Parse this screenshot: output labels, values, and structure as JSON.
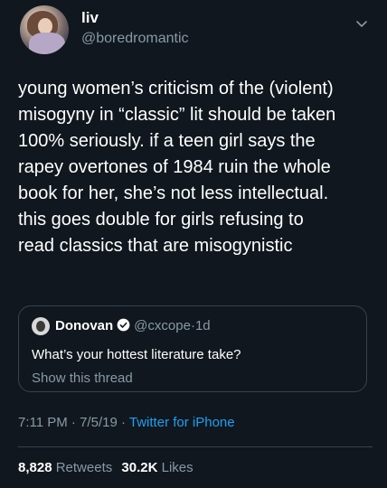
{
  "user": {
    "display_name": "liv",
    "handle": "@boredromantic"
  },
  "tweet": {
    "lines": [
      "young women’s criticism of the (violent)",
      "misogyny in “classic” lit should be taken",
      "100% seriously. if a teen girl says the",
      "rapey overtones of 1984 ruin the whole",
      "book for her, she’s not less intellectual.",
      "this goes double for girls refusing to",
      "read classics that are misogynistic"
    ]
  },
  "quoted": {
    "name": "Donovan",
    "handle": "@cxcope",
    "separator": "·",
    "time": "1d",
    "text": "What’s your hottest literature take?",
    "link": "Show this thread"
  },
  "meta": {
    "time": "7:11 PM",
    "sep1": "·",
    "date": "7/5/19",
    "sep2": "·",
    "source": "Twitter for iPhone"
  },
  "stats": {
    "retweets_count": "8,828",
    "retweets_label": "Retweets",
    "likes_count": "30.2K",
    "likes_label": "Likes"
  },
  "colors": {
    "background": "#10171e",
    "muted": "#8899a6",
    "accent": "#1da1f2",
    "border": "#38444d"
  },
  "icons": {
    "menu": "chevron-down-icon",
    "verified": "verified-badge-icon"
  }
}
